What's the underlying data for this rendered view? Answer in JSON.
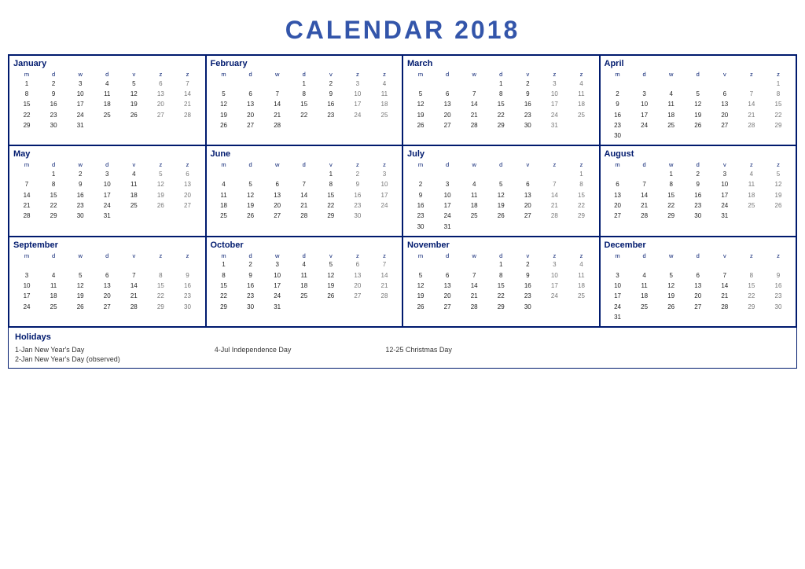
{
  "title": "CALENDAR 2018",
  "months": [
    {
      "name": "January",
      "headers": [
        "m",
        "d",
        "w",
        "d",
        "v",
        "z",
        "z"
      ],
      "weeks": [
        [
          "",
          "1",
          "2",
          "3",
          "4",
          "5",
          "6",
          "7"
        ],
        [
          "",
          "8",
          "9",
          "10",
          "11",
          "12",
          "13",
          "14"
        ],
        [
          "",
          "15",
          "16",
          "17",
          "18",
          "19",
          "20",
          "21"
        ],
        [
          "",
          "22",
          "23",
          "24",
          "25",
          "26",
          "27",
          "28"
        ],
        [
          "",
          "29",
          "30",
          "31",
          "",
          "",
          "",
          ""
        ]
      ]
    },
    {
      "name": "February",
      "headers": [
        "m",
        "d",
        "w",
        "d",
        "v",
        "z",
        "z"
      ],
      "weeks": [
        [
          "",
          "",
          "",
          "",
          "1",
          "2",
          "3",
          "4"
        ],
        [
          "",
          "5",
          "6",
          "7",
          "8",
          "9",
          "10",
          "11"
        ],
        [
          "",
          "12",
          "13",
          "14",
          "15",
          "16",
          "17",
          "18"
        ],
        [
          "",
          "19",
          "20",
          "21",
          "22",
          "23",
          "24",
          "25"
        ],
        [
          "",
          "26",
          "27",
          "28",
          "",
          "",
          "",
          ""
        ]
      ]
    },
    {
      "name": "March",
      "headers": [
        "m",
        "d",
        "w",
        "d",
        "v",
        "z",
        "z"
      ],
      "weeks": [
        [
          "",
          "",
          "",
          "",
          "1",
          "2",
          "3",
          "4"
        ],
        [
          "",
          "5",
          "6",
          "7",
          "8",
          "9",
          "10",
          "11"
        ],
        [
          "",
          "12",
          "13",
          "14",
          "15",
          "16",
          "17",
          "18"
        ],
        [
          "",
          "19",
          "20",
          "21",
          "22",
          "23",
          "24",
          "25"
        ],
        [
          "",
          "26",
          "27",
          "28",
          "29",
          "30",
          "31",
          ""
        ]
      ]
    },
    {
      "name": "April",
      "headers": [
        "m",
        "d",
        "w",
        "d",
        "v",
        "z",
        "z"
      ],
      "weeks": [
        [
          "",
          "",
          "",
          "",
          "",
          "",
          "",
          "1"
        ],
        [
          "",
          "2",
          "3",
          "4",
          "5",
          "6",
          "7",
          "8"
        ],
        [
          "",
          "9",
          "10",
          "11",
          "12",
          "13",
          "14",
          "15"
        ],
        [
          "",
          "16",
          "17",
          "18",
          "19",
          "20",
          "21",
          "22"
        ],
        [
          "",
          "23",
          "24",
          "25",
          "26",
          "27",
          "28",
          "29"
        ],
        [
          "",
          "30",
          "",
          "",
          "",
          "",
          "",
          ""
        ]
      ]
    },
    {
      "name": "May",
      "headers": [
        "m",
        "d",
        "w",
        "d",
        "v",
        "z",
        "z"
      ],
      "weeks": [
        [
          "",
          "",
          "1",
          "2",
          "3",
          "4",
          "5",
          "6"
        ],
        [
          "",
          "7",
          "8",
          "9",
          "10",
          "11",
          "12",
          "13"
        ],
        [
          "",
          "14",
          "15",
          "16",
          "17",
          "18",
          "19",
          "20"
        ],
        [
          "",
          "21",
          "22",
          "23",
          "24",
          "25",
          "26",
          "27"
        ],
        [
          "",
          "28",
          "29",
          "30",
          "31",
          "",
          "",
          ""
        ]
      ]
    },
    {
      "name": "June",
      "headers": [
        "m",
        "d",
        "w",
        "d",
        "v",
        "z",
        "z"
      ],
      "weeks": [
        [
          "",
          "",
          "",
          "",
          "",
          "1",
          "2",
          "3"
        ],
        [
          "",
          "4",
          "5",
          "6",
          "7",
          "8",
          "9",
          "10"
        ],
        [
          "",
          "11",
          "12",
          "13",
          "14",
          "15",
          "16",
          "17"
        ],
        [
          "",
          "18",
          "19",
          "20",
          "21",
          "22",
          "23",
          "24"
        ],
        [
          "",
          "25",
          "26",
          "27",
          "28",
          "29",
          "30",
          ""
        ]
      ]
    },
    {
      "name": "July",
      "headers": [
        "m",
        "d",
        "w",
        "d",
        "v",
        "z",
        "z"
      ],
      "weeks": [
        [
          "",
          "",
          "",
          "",
          "",
          "",
          "",
          "1"
        ],
        [
          "",
          "2",
          "3",
          "4",
          "5",
          "6",
          "7",
          "8"
        ],
        [
          "",
          "9",
          "10",
          "11",
          "12",
          "13",
          "14",
          "15"
        ],
        [
          "",
          "16",
          "17",
          "18",
          "19",
          "20",
          "21",
          "22"
        ],
        [
          "",
          "23",
          "24",
          "25",
          "26",
          "27",
          "28",
          "29"
        ],
        [
          "",
          "30",
          "31",
          "",
          "",
          "",
          "",
          ""
        ]
      ]
    },
    {
      "name": "August",
      "headers": [
        "m",
        "d",
        "w",
        "d",
        "v",
        "z",
        "z"
      ],
      "weeks": [
        [
          "",
          "",
          "",
          "1",
          "2",
          "3",
          "4",
          "5"
        ],
        [
          "",
          "6",
          "7",
          "8",
          "9",
          "10",
          "11",
          "12"
        ],
        [
          "",
          "13",
          "14",
          "15",
          "16",
          "17",
          "18",
          "19"
        ],
        [
          "",
          "20",
          "21",
          "22",
          "23",
          "24",
          "25",
          "26"
        ],
        [
          "",
          "27",
          "28",
          "29",
          "30",
          "31",
          "",
          ""
        ]
      ]
    },
    {
      "name": "September",
      "headers": [
        "m",
        "d",
        "w",
        "d",
        "v",
        "z",
        "z"
      ],
      "weeks": [
        [
          "",
          "",
          "",
          "",
          "",
          "",
          "",
          ""
        ],
        [
          "",
          "3",
          "4",
          "5",
          "6",
          "7",
          "8",
          "9"
        ],
        [
          "",
          "10",
          "11",
          "12",
          "13",
          "14",
          "15",
          "16"
        ],
        [
          "",
          "17",
          "18",
          "19",
          "20",
          "21",
          "22",
          "23"
        ],
        [
          "",
          "24",
          "25",
          "26",
          "27",
          "28",
          "29",
          "30"
        ]
      ]
    },
    {
      "name": "October",
      "headers": [
        "m",
        "d",
        "w",
        "d",
        "v",
        "z",
        "z"
      ],
      "weeks": [
        [
          "",
          "1",
          "2",
          "3",
          "4",
          "5",
          "6",
          "7"
        ],
        [
          "",
          "8",
          "9",
          "10",
          "11",
          "12",
          "13",
          "14"
        ],
        [
          "",
          "15",
          "16",
          "17",
          "18",
          "19",
          "20",
          "21"
        ],
        [
          "",
          "22",
          "23",
          "24",
          "25",
          "26",
          "27",
          "28"
        ],
        [
          "",
          "29",
          "30",
          "31",
          "",
          "",
          "",
          ""
        ]
      ]
    },
    {
      "name": "November",
      "headers": [
        "m",
        "d",
        "w",
        "d",
        "v",
        "z",
        "z"
      ],
      "weeks": [
        [
          "",
          "",
          "",
          "",
          "1",
          "2",
          "3",
          "4"
        ],
        [
          "",
          "5",
          "6",
          "7",
          "8",
          "9",
          "10",
          "11"
        ],
        [
          "",
          "12",
          "13",
          "14",
          "15",
          "16",
          "17",
          "18"
        ],
        [
          "",
          "19",
          "20",
          "21",
          "22",
          "23",
          "24",
          "25"
        ],
        [
          "",
          "26",
          "27",
          "28",
          "29",
          "30",
          "",
          ""
        ]
      ]
    },
    {
      "name": "December",
      "headers": [
        "m",
        "d",
        "w",
        "d",
        "v",
        "z",
        "z"
      ],
      "weeks": [
        [
          "",
          "",
          "",
          "",
          "",
          "",
          "",
          ""
        ],
        [
          "",
          "3",
          "4",
          "5",
          "6",
          "7",
          "8",
          "9"
        ],
        [
          "",
          "10",
          "11",
          "12",
          "13",
          "14",
          "15",
          "16"
        ],
        [
          "",
          "17",
          "18",
          "19",
          "20",
          "21",
          "22",
          "23"
        ],
        [
          "",
          "24",
          "25",
          "26",
          "27",
          "28",
          "29",
          "30"
        ],
        [
          "",
          "31",
          "",
          "",
          "",
          "",
          "",
          ""
        ]
      ]
    }
  ],
  "holidays": {
    "title": "Holidays",
    "items": [
      {
        "date": "1-Jan",
        "name": "New Year's Day"
      },
      {
        "date": "2-Jan",
        "name": "New Year's Day (observed)"
      },
      {
        "date": "4-Jul",
        "name": "Independence Day"
      },
      {
        "date": "12-25",
        "name": "Christmas Day"
      }
    ]
  }
}
